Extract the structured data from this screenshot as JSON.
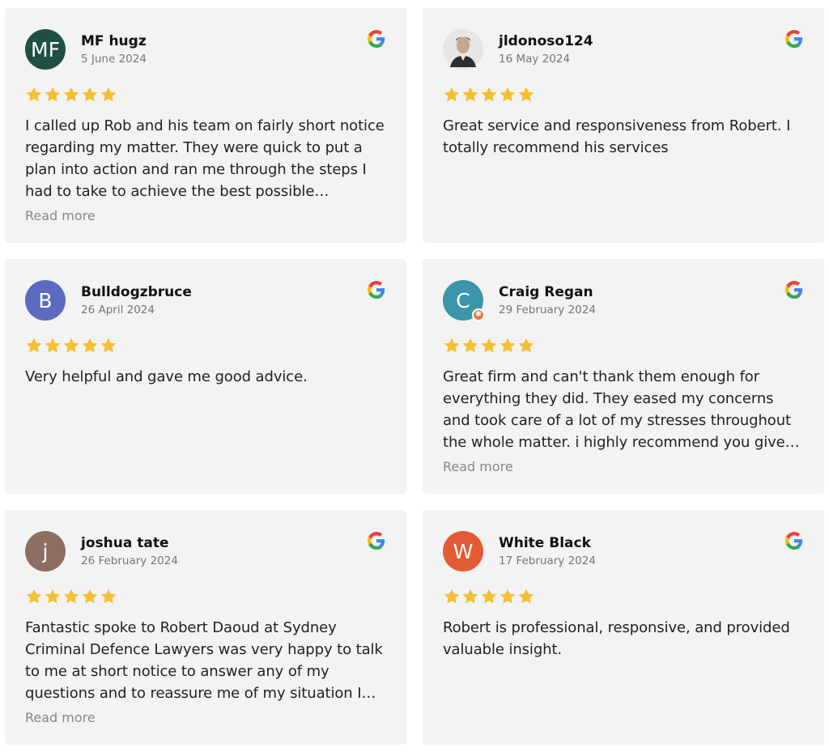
{
  "colors": {
    "star": "#f4c033",
    "card_bg": "#f3f3f3"
  },
  "reviews": [
    {
      "name": "MF hugz",
      "date": "5 June 2024",
      "avatar_initials": "MF",
      "avatar_color": "#1f4f45",
      "rating": 5,
      "text": "I called up Rob and his team on fairly short notice regarding my matter. They were quick to put a plan into action and ran me through the steps I had to take to achieve the best possible outcome...",
      "read_more": "Read more"
    },
    {
      "name": "jldonoso124",
      "date": "16 May 2024",
      "avatar_initials": "",
      "avatar_color": "#e4e4e4",
      "avatar_kind": "photo",
      "rating": 5,
      "text": "Great service and responsiveness from Robert. I totally recommend his services",
      "read_more": ""
    },
    {
      "name": "Bulldogzbruce",
      "date": "26 April 2024",
      "avatar_initials": "B",
      "avatar_color": "#5c6bc0",
      "rating": 5,
      "text": "Very helpful and gave me good advice.",
      "read_more": ""
    },
    {
      "name": "Craig Regan",
      "date": "29 February 2024",
      "avatar_initials": "C",
      "avatar_color": "#3a96a8",
      "avatar_badge": "local-guide-badge",
      "rating": 5,
      "text": "Great firm and can't thank them enough for everything they did. They eased my concerns and took care of a lot of my stresses throughout the whole matter. i highly recommend you give them...",
      "read_more": "Read more"
    },
    {
      "name": "joshua tate",
      "date": "26 February 2024",
      "avatar_initials": "j",
      "avatar_color": "#8d6e63",
      "rating": 5,
      "text": "Fantastic spoke to Robert Daoud at Sydney Criminal Defence Lawyers was very happy to talk to me at short notice to answer any of my questions and to reassure me of my situation I fe...",
      "read_more": "Read more"
    },
    {
      "name": "White Black",
      "date": "17 February 2024",
      "avatar_initials": "W",
      "avatar_color": "#e35b34",
      "rating": 5,
      "text": "Robert is professional, responsive, and provided valuable insight.",
      "read_more": ""
    }
  ],
  "icons": {
    "source": "google-g-icon",
    "rating": "star-icon"
  }
}
